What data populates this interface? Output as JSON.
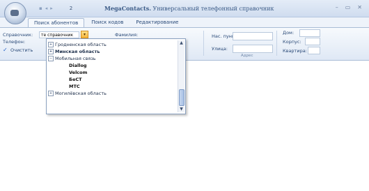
{
  "app": {
    "title_brand": "MegaContacts.",
    "title_rest": "Универсальный телефонный справочник",
    "tab_number": "2"
  },
  "window_controls": {
    "minimize": "–",
    "maximize": "▭",
    "close": "✕"
  },
  "tabs": [
    {
      "label": "Поиск абонентов"
    },
    {
      "label": "Поиск кодов"
    },
    {
      "label": "Редактирование"
    }
  ],
  "ribbon": {
    "reference_label": "Справочник:",
    "reference_value": "те справочник",
    "phone_label": "Телефон:",
    "surname_label": "Фамилия:",
    "clear_label": "Очистить",
    "locality_label": "Нас. пункт:",
    "street_label": "Улица:",
    "house_label": "Дом:",
    "building_label": "Корпус:",
    "apartment_label": "Квартира:",
    "address_group_label": "Адрес"
  },
  "dropdown": {
    "items": [
      {
        "label": "Гродненская область"
      },
      {
        "label": "Минская область"
      },
      {
        "label": "Мобильная связь"
      },
      {
        "label": "Diallog"
      },
      {
        "label": "Velcom"
      },
      {
        "label": "БеСТ"
      },
      {
        "label": "МТС"
      },
      {
        "label": "Могилёвская область"
      }
    ]
  },
  "colors": {
    "accent": "#f5b53a",
    "ribbon_border": "#a9bcd6",
    "text_blue": "#2a4a78"
  }
}
